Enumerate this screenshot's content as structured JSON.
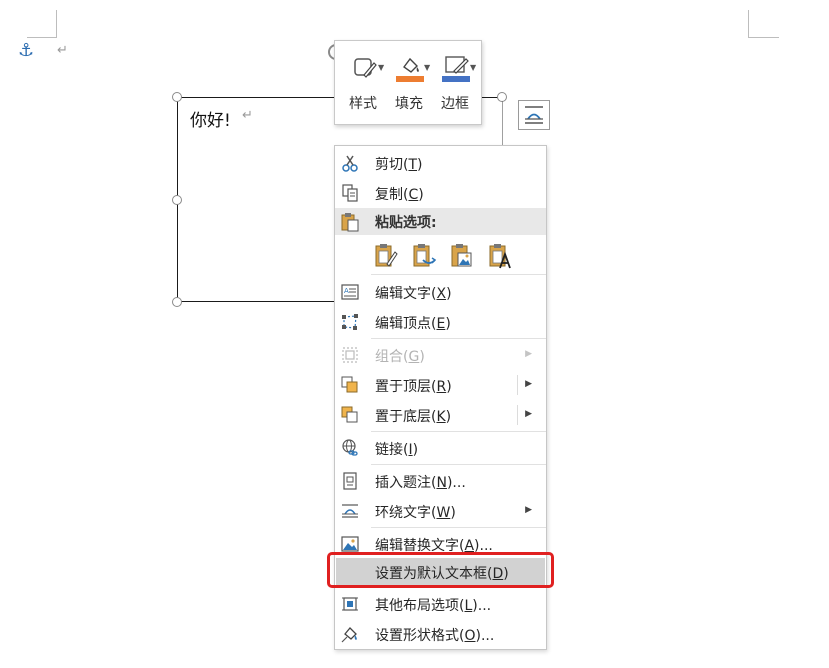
{
  "document": {
    "paragraph_mark": "↵",
    "textbox_text": "你好!",
    "textbox_paragraph_mark": "↵",
    "anchor_icon": "anchor-icon"
  },
  "mini_toolbar": {
    "buttons": [
      {
        "label": "样式",
        "icon": "shape-style-icon"
      },
      {
        "label": "填充",
        "icon": "paint-bucket-icon",
        "color": "#ed7d31"
      },
      {
        "label": "边框",
        "icon": "pen-outline-icon",
        "color": "#4472c4"
      }
    ]
  },
  "context_menu": {
    "items": {
      "cut": {
        "label": "剪切(T)",
        "icon": "scissors-icon"
      },
      "copy": {
        "label": "复制(C)",
        "icon": "copy-icon"
      },
      "paste_header": {
        "label": "粘贴选项:",
        "icon": "clipboard-icon"
      },
      "paste_options": [
        "paste-keep-source-icon",
        "paste-merge-icon",
        "paste-picture-icon",
        "paste-text-only-icon"
      ],
      "edit_text": {
        "label": "编辑文字(X)",
        "icon": "edit-text-icon"
      },
      "edit_points": {
        "label": "编辑顶点(E)",
        "icon": "edit-points-icon"
      },
      "group": {
        "label": "组合(G)",
        "icon": "group-icon",
        "disabled": true
      },
      "bring_front": {
        "label": "置于顶层(R)",
        "icon": "bring-front-icon"
      },
      "send_back": {
        "label": "置于底层(K)",
        "icon": "send-back-icon"
      },
      "link": {
        "label": "链接(I)",
        "icon": "link-globe-icon"
      },
      "insert_caption": {
        "label": "插入题注(N)...",
        "icon": "caption-icon"
      },
      "wrap_text": {
        "label": "环绕文字(W)",
        "icon": "wrap-text-icon"
      },
      "edit_alt_text": {
        "label": "编辑替换文字(A)...",
        "icon": "alt-text-icon"
      },
      "set_default_textbox": {
        "label": "设置为默认文本框(D)"
      },
      "more_layout": {
        "label": "其他布局选项(L)...",
        "icon": "layout-options-icon"
      },
      "format_shape": {
        "label": "设置形状格式(O)...",
        "icon": "format-shape-icon"
      }
    }
  },
  "colors": {
    "highlight_frame": "#e02020",
    "fill_orange": "#ed7d31",
    "border_blue": "#4472c4"
  }
}
